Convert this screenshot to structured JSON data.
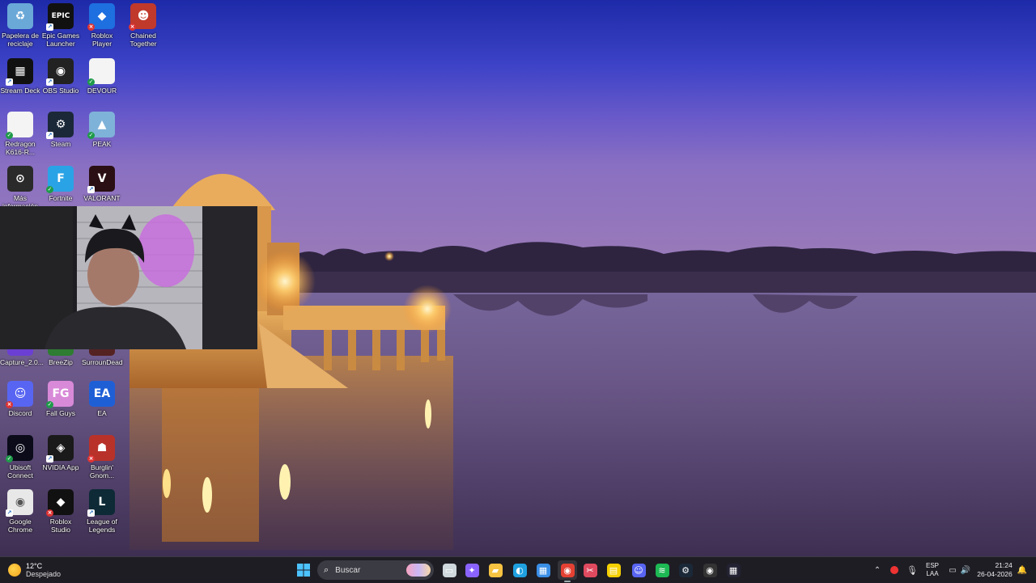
{
  "desktop": {
    "icons": [
      {
        "name": "recycle-bin",
        "label": "Papelera de reciclaje",
        "color": "#6aa8d8",
        "glyph": "♻",
        "badge": ""
      },
      {
        "name": "epic-games-launcher",
        "label": "Epic Games Launcher",
        "color": "#111111",
        "glyph": "EPIC",
        "badge": "short"
      },
      {
        "name": "roblox-player",
        "label": "Roblox Player",
        "color": "#1e6fe0",
        "glyph": "◆",
        "badge": "err"
      },
      {
        "name": "chained-together",
        "label": "Chained Together",
        "color": "#c0392b",
        "glyph": "☻",
        "badge": "err"
      },
      {
        "name": "stream-deck",
        "label": "Stream Deck",
        "color": "#111111",
        "glyph": "▦",
        "badge": "short"
      },
      {
        "name": "obs-studio",
        "label": "OBS Studio",
        "color": "#222222",
        "glyph": "◉",
        "badge": "short"
      },
      {
        "name": "devour",
        "label": "DEVOUR",
        "color": "#f4f4f4",
        "glyph": "",
        "badge": "ok"
      },
      {
        "name": "redragon",
        "label": "Redragon K616-R...",
        "color": "#f4f4f4",
        "glyph": "",
        "badge": "ok"
      },
      {
        "name": "steam",
        "label": "Steam",
        "color": "#1b2838",
        "glyph": "⚙",
        "badge": "short"
      },
      {
        "name": "peak",
        "label": "PEAK",
        "color": "#7fb2d8",
        "glyph": "▲",
        "badge": "ok"
      },
      {
        "name": "mas-informacion",
        "label": "Más información",
        "color": "#2a2a2a",
        "glyph": "⊙",
        "badge": ""
      },
      {
        "name": "fortnite",
        "label": "Fortnite",
        "color": "#2aa3e6",
        "glyph": "F",
        "badge": "ok"
      },
      {
        "name": "valorant",
        "label": "VALORANT",
        "color": "#2a0f14",
        "glyph": "V",
        "badge": "short"
      },
      {
        "name": "capture",
        "label": "Capture_2.0...",
        "color": "#6b3fd3",
        "glyph": "",
        "badge": ""
      },
      {
        "name": "breezip",
        "label": "BreeZip",
        "color": "#2e7d32",
        "glyph": "",
        "badge": ""
      },
      {
        "name": "surroundead",
        "label": "SurrounDead",
        "color": "#552222",
        "glyph": "",
        "badge": ""
      },
      {
        "name": "discord",
        "label": "Discord",
        "color": "#5865f2",
        "glyph": "☺",
        "badge": "err"
      },
      {
        "name": "fall-guys",
        "label": "Fall Guys",
        "color": "#d88ad8",
        "glyph": "FG",
        "badge": "ok"
      },
      {
        "name": "ea",
        "label": "EA",
        "color": "#1f5fd6",
        "glyph": "EA",
        "badge": ""
      },
      {
        "name": "ubisoft-connect",
        "label": "Ubisoft Connect",
        "color": "#0b0b1a",
        "glyph": "◎",
        "badge": "ok"
      },
      {
        "name": "nvidia-app",
        "label": "NVIDIA App",
        "color": "#1a1a1a",
        "glyph": "◈",
        "badge": "short"
      },
      {
        "name": "burglin-gnomes",
        "label": "Burglin' Gnom...",
        "color": "#b8322a",
        "glyph": "☗",
        "badge": "err"
      },
      {
        "name": "google-chrome",
        "label": "Google Chrome",
        "color": "#e8e8e8",
        "glyph": "◉",
        "badge": "short"
      },
      {
        "name": "roblox-studio",
        "label": "Roblox Studio",
        "color": "#111111",
        "glyph": "◆",
        "badge": "err"
      },
      {
        "name": "league-of-legends",
        "label": "League of Legends",
        "color": "#0d2a36",
        "glyph": "L",
        "badge": "short"
      }
    ]
  },
  "taskbar": {
    "weather": {
      "temp": "12°C",
      "condition": "Despejado"
    },
    "search_placeholder": "Buscar",
    "apps": [
      {
        "name": "task-view-icon",
        "color": "#cfd8dc",
        "glyph": "▭"
      },
      {
        "name": "copilot-icon",
        "color": "#8a63ff",
        "glyph": "✦"
      },
      {
        "name": "file-explorer-icon",
        "color": "#f6c342",
        "glyph": "▰"
      },
      {
        "name": "edge-icon",
        "color": "#1fa1e0",
        "glyph": "◐"
      },
      {
        "name": "store-icon",
        "color": "#3a8ee6",
        "glyph": "▦"
      },
      {
        "name": "chrome-icon",
        "color": "#e44133",
        "glyph": "◉"
      },
      {
        "name": "snipping-tool-icon",
        "color": "#e04a5f",
        "glyph": "✂"
      },
      {
        "name": "sticky-notes-icon",
        "color": "#f5d000",
        "glyph": "▤"
      },
      {
        "name": "discord-icon",
        "color": "#5865f2",
        "glyph": "☺"
      },
      {
        "name": "spotify-icon",
        "color": "#1db954",
        "glyph": "≋"
      },
      {
        "name": "steam-icon",
        "color": "#1b2838",
        "glyph": "⚙"
      },
      {
        "name": "obs-icon",
        "color": "#333333",
        "glyph": "◉"
      },
      {
        "name": "stream-deck-icon",
        "color": "#222233",
        "glyph": "▦"
      }
    ],
    "tray": {
      "language": "ESP",
      "layout": "LAA",
      "time": "21:24",
      "date": "26-04-2026"
    }
  }
}
